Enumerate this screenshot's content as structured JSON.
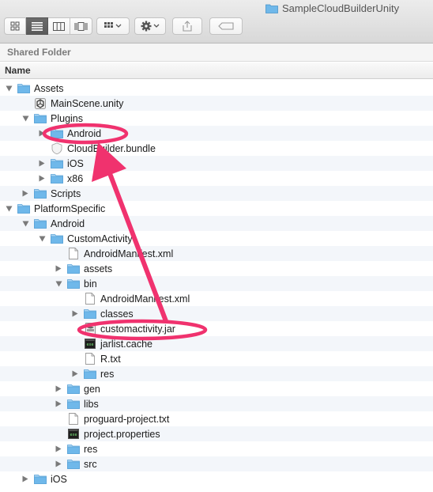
{
  "window": {
    "title": "SampleCloudBuilderUnity",
    "title_icon": "folder-icon"
  },
  "toolbar": {
    "view_modes": [
      {
        "name": "icon-view",
        "icon": "grid-icon",
        "active": false
      },
      {
        "name": "list-view",
        "icon": "list-icon",
        "active": true
      },
      {
        "name": "column-view",
        "icon": "columns-icon",
        "active": false
      },
      {
        "name": "coverflow-view",
        "icon": "coverflow-icon",
        "active": false
      }
    ],
    "arrange_icon": "arrange-grid-icon",
    "action_icon": "gear-icon",
    "share_icon": "share-icon",
    "tag_icon": "tag-icon"
  },
  "sidebar_header": "Shared Folder",
  "column_header": "Name",
  "tree": [
    {
      "label": "Assets",
      "indent": 0,
      "disclosure": "open",
      "icon": "folder"
    },
    {
      "label": "MainScene.unity",
      "indent": 1,
      "disclosure": "none",
      "icon": "unity"
    },
    {
      "label": "Plugins",
      "indent": 1,
      "disclosure": "open",
      "icon": "folder"
    },
    {
      "label": "Android",
      "indent": 2,
      "disclosure": "closed",
      "icon": "folder"
    },
    {
      "label": "CloudBuilder.bundle",
      "indent": 2,
      "disclosure": "none",
      "icon": "bundle"
    },
    {
      "label": "iOS",
      "indent": 2,
      "disclosure": "closed",
      "icon": "folder"
    },
    {
      "label": "x86",
      "indent": 2,
      "disclosure": "closed",
      "icon": "folder"
    },
    {
      "label": "Scripts",
      "indent": 1,
      "disclosure": "closed",
      "icon": "folder"
    },
    {
      "label": "PlatformSpecific",
      "indent": 0,
      "disclosure": "open",
      "icon": "folder"
    },
    {
      "label": "Android",
      "indent": 1,
      "disclosure": "open",
      "icon": "folder"
    },
    {
      "label": "CustomActivity",
      "indent": 2,
      "disclosure": "open",
      "icon": "folder"
    },
    {
      "label": "AndroidManifest.xml",
      "indent": 3,
      "disclosure": "none",
      "icon": "doc"
    },
    {
      "label": "assets",
      "indent": 3,
      "disclosure": "closed",
      "icon": "folder"
    },
    {
      "label": "bin",
      "indent": 3,
      "disclosure": "open",
      "icon": "folder"
    },
    {
      "label": "AndroidManifest.xml",
      "indent": 4,
      "disclosure": "none",
      "icon": "doc"
    },
    {
      "label": "classes",
      "indent": 4,
      "disclosure": "closed",
      "icon": "folder"
    },
    {
      "label": "customactivity.jar",
      "indent": 4,
      "disclosure": "none",
      "icon": "jar"
    },
    {
      "label": "jarlist.cache",
      "indent": 4,
      "disclosure": "none",
      "icon": "exec"
    },
    {
      "label": "R.txt",
      "indent": 4,
      "disclosure": "none",
      "icon": "doc"
    },
    {
      "label": "res",
      "indent": 4,
      "disclosure": "closed",
      "icon": "folder"
    },
    {
      "label": "gen",
      "indent": 3,
      "disclosure": "closed",
      "icon": "folder"
    },
    {
      "label": "libs",
      "indent": 3,
      "disclosure": "closed",
      "icon": "folder"
    },
    {
      "label": "proguard-project.txt",
      "indent": 3,
      "disclosure": "none",
      "icon": "doc"
    },
    {
      "label": "project.properties",
      "indent": 3,
      "disclosure": "none",
      "icon": "exec"
    },
    {
      "label": "res",
      "indent": 3,
      "disclosure": "closed",
      "icon": "folder"
    },
    {
      "label": "src",
      "indent": 3,
      "disclosure": "closed",
      "icon": "folder"
    },
    {
      "label": "iOS",
      "indent": 1,
      "disclosure": "closed",
      "icon": "folder"
    }
  ],
  "colors": {
    "folder": "#6fb8ea",
    "annotation": "#f0326e"
  },
  "annotations": {
    "highlight_rows": [
      "Plugins/Android",
      "bin/customactivity.jar"
    ],
    "arrow": "from customactivity.jar to Plugins/Android"
  }
}
